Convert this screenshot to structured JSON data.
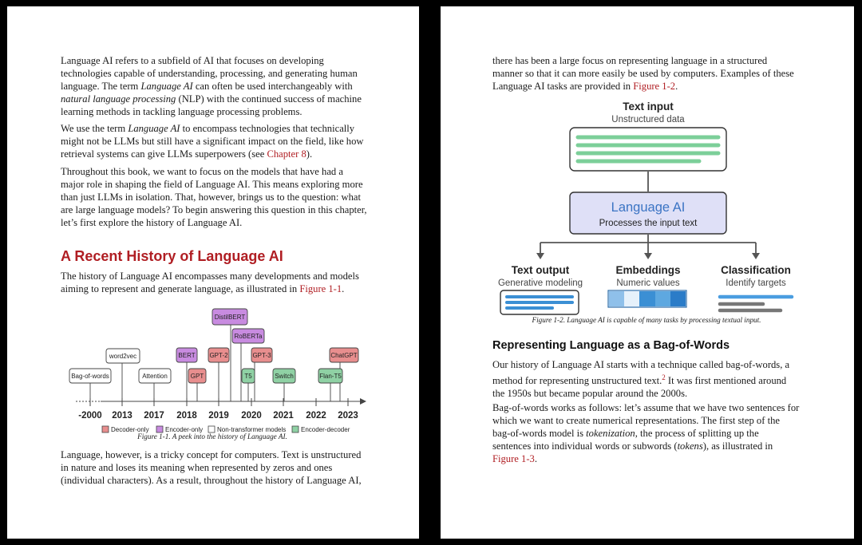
{
  "left_page": {
    "paragraphs": [
      [
        "Language AI refers to a subfield of AI that focuses on developing",
        "technologies capable of understanding, processing, and generating human",
        "language. The term ",
        "Language AI",
        " can often be used interchangeably with",
        "natural language processing",
        " (NLP) with the continued success of machine",
        "learning methods in tackling language processing problems."
      ],
      [
        "We use the term ",
        "Language AI",
        " to encompass technologies that technically",
        "might not be LLMs but still have a significant impact on the field, like how",
        "retrieval systems can give LLMs superpowers (see ",
        "Chapter 8",
        ")."
      ],
      [
        "Throughout this book, we want to focus on the models that have had a",
        "major role in shaping the field of Language AI. This means exploring more",
        "than just LLMs in isolation. That, however, brings us to the question: what",
        "are large language models? To begin answering this question in this chapter,",
        "let’s first explore the history of Language AI."
      ]
    ],
    "heading": "A Recent History of Language AI",
    "history_para": [
      "The history of Language AI encompasses many developments and models",
      "aiming to represent and generate language, as illustrated in ",
      "Figure 1-1",
      "."
    ],
    "timeline": {
      "models": [
        "Bag-of-words",
        "word2vec",
        "Attention",
        "BERT",
        "GPT",
        "GPT-2",
        "DistilBERT",
        "RoBERTa",
        "T5",
        "GPT-3",
        "Switch",
        "ChatGPT",
        "Flan-T5"
      ],
      "years": [
        "-2000",
        "2013",
        "2017",
        "2018",
        "2019",
        "2020",
        "2021",
        "2022",
        "2023"
      ],
      "legend": [
        "Decoder-only",
        "Encoder-only",
        "Non-transformer models",
        "Encoder-decoder"
      ],
      "colors": {
        "decoder": "#e88e8e",
        "encoder": "#c88be0",
        "non_transformer": "#ffffff",
        "encoder_decoder": "#8fd1a4"
      }
    },
    "caption": "Figure 1-1. A peek into the history of Language AI.",
    "final_para": [
      "Language, however, is a tricky concept for computers. Text is unstructured",
      "in nature and loses its meaning when represented by zeros and ones",
      "(individual characters). As a result, throughout the history of Language AI,"
    ]
  },
  "right_page": {
    "intro_para": [
      "there has been a large focus on representing language in a structured",
      "manner so that it can more easily be used by computers. Examples of these",
      "Language AI tasks are provided in ",
      "Figure 1-2",
      "."
    ],
    "diagram": {
      "input_title": "Text input",
      "input_sub": "Unstructured data",
      "center_title": "Language AI",
      "center_sub": "Processes the input text",
      "outputs": [
        {
          "title": "Text output",
          "sub": "Generative modeling"
        },
        {
          "title": "Embeddings",
          "sub": "Numeric values"
        },
        {
          "title": "Classification",
          "sub": "Identify targets"
        }
      ],
      "colors": {
        "green": "#7ccf99",
        "blue": "#3b8fd4",
        "purple_fill": "#dfe0f7",
        "gray": "#777777"
      }
    },
    "caption": "Figure 1-2. Language AI is capable of many tasks by processing textual input.",
    "heading": "Representing Language as a Bag-of-Words",
    "para1": [
      "Our history of Language AI starts with a technique called bag-of-words, a",
      "method for representing unstructured text.",
      "2",
      " It was first mentioned around",
      "the 1950s but became popular around the 2000s."
    ],
    "para2": [
      "Bag-of-words works as follows: let’s assume that we have two sentences for",
      "which we want to create numerical representations. The first step of the",
      "bag-of-words model is ",
      "tokenization",
      ", the process of splitting up the",
      "sentences into individual words or subwords (",
      "tokens",
      "), as illustrated in",
      "Figure 1-3",
      "."
    ]
  }
}
